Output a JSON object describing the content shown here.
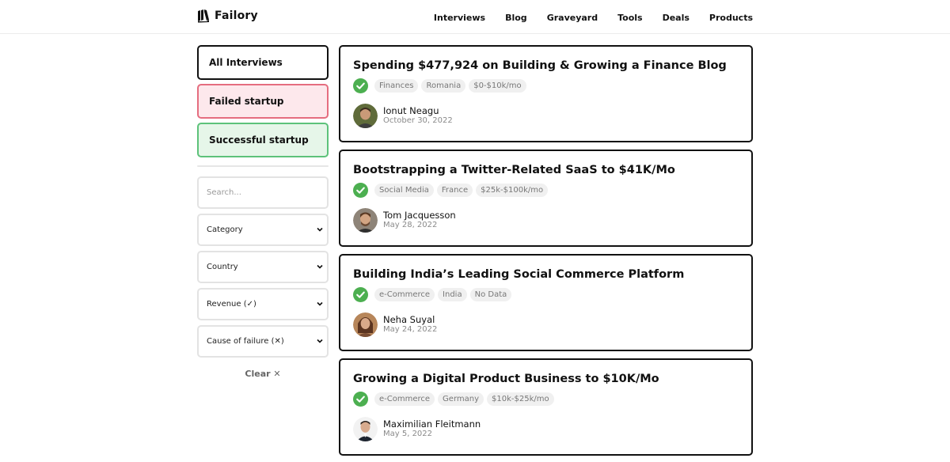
{
  "brand": {
    "name": "Failory"
  },
  "nav": [
    {
      "label": "Interviews"
    },
    {
      "label": "Blog"
    },
    {
      "label": "Graveyard"
    },
    {
      "label": "Tools"
    },
    {
      "label": "Deals"
    },
    {
      "label": "Products"
    }
  ],
  "sidebar": {
    "filters": {
      "all": "All Interviews",
      "failed": "Failed startup",
      "successful": "Successful startup"
    },
    "search_placeholder": "Search...",
    "selects": {
      "category": "Category",
      "country": "Country",
      "revenue": "Revenue (✓)",
      "cause": "Cause of failure (✕)"
    },
    "clear_label": "Clear ✕"
  },
  "interviews": [
    {
      "title": "Spending $477,924 on Building & Growing a Finance Blog",
      "tags": [
        "Finances",
        "Romania",
        "$0-$10k/mo"
      ],
      "author": "Ionut Neagu",
      "date": "October 30, 2022"
    },
    {
      "title": "Bootstrapping a Twitter-Related SaaS to $41K/Mo",
      "tags": [
        "Social Media",
        "France",
        "$25k-$100k/mo"
      ],
      "author": "Tom Jacquesson",
      "date": "May 28, 2022"
    },
    {
      "title": "Building India’s Leading Social Commerce Platform",
      "tags": [
        "e-Commerce",
        "India",
        "No Data"
      ],
      "author": "Neha Suyal",
      "date": "May 24, 2022"
    },
    {
      "title": "Growing a Digital Product Business to $10K/Mo",
      "tags": [
        "e-Commerce",
        "Germany",
        "$10k-$25k/mo"
      ],
      "author": "Maximilian Fleitmann",
      "date": "May 5, 2022"
    }
  ],
  "icons": {
    "success_check": "check-circle-icon",
    "logo": "book-stack-icon",
    "dropdown": "chevron-down-icon"
  },
  "colors": {
    "success": "#4caf50",
    "failed_bg": "#fde8ec",
    "failed_border": "#e56d7f",
    "success_bg": "#e6f6e9",
    "success_border": "#5dc27a"
  }
}
